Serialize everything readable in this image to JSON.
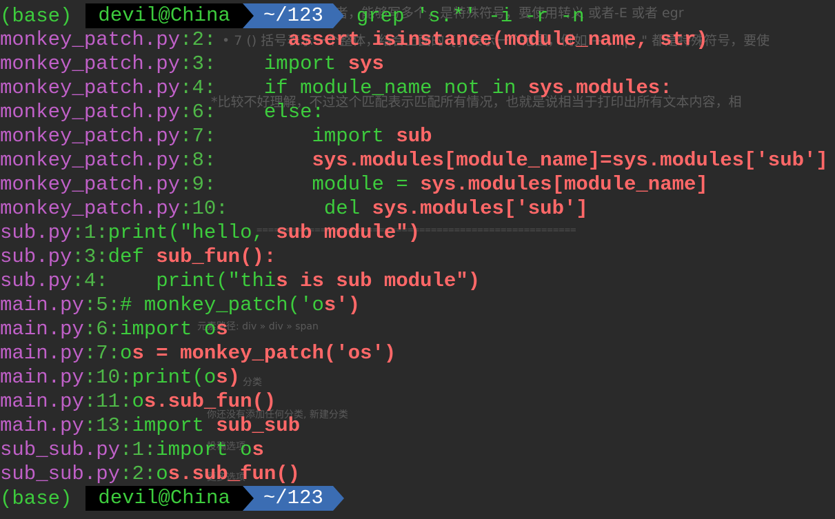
{
  "prompt": {
    "env": "(base)",
    "user_host": "devil@China",
    "dir": "~/123",
    "command": "grep 's.*' -i -r -n"
  },
  "lines": [
    {
      "file": "monkey_patch.py",
      "line": "2",
      "indent": "      ",
      "pre": "",
      "match": "assert isinstance(module_name, str)",
      "post": ""
    },
    {
      "file": "monkey_patch.py",
      "line": "3",
      "indent": "    ",
      "pre": "import ",
      "match": "sys",
      "post": ""
    },
    {
      "file": "monkey_patch.py",
      "line": "4",
      "indent": "    ",
      "pre": "if module_name not in ",
      "match": "sys.modules:",
      "post": ""
    },
    {
      "file": "monkey_patch.py",
      "line": "6",
      "indent": "    ",
      "pre": "else:",
      "match": "",
      "post": ""
    },
    {
      "file": "monkey_patch.py",
      "line": "7",
      "indent": "        ",
      "pre": "import ",
      "match": "sub",
      "post": ""
    },
    {
      "file": "monkey_patch.py",
      "line": "8",
      "indent": "        ",
      "pre": "",
      "match": "sys.modules[module_name]=sys.modules['sub']",
      "post": ""
    },
    {
      "file": "monkey_patch.py",
      "line": "9",
      "indent": "        ",
      "pre": "module = ",
      "match": "sys.modules[module_name]",
      "post": ""
    },
    {
      "file": "monkey_patch.py",
      "line": "10",
      "indent": "        ",
      "pre": "del ",
      "match": "sys.modules['sub']",
      "post": ""
    },
    {
      "file": "sub.py",
      "line": "1",
      "indent": "",
      "pre": "print(\"hello, ",
      "match": "sub module\")",
      "post": ""
    },
    {
      "file": "sub.py",
      "line": "3",
      "indent": "",
      "pre": "def ",
      "match": "sub_fun():",
      "post": ""
    },
    {
      "file": "sub.py",
      "line": "4",
      "indent": "    ",
      "pre": "print(\"thi",
      "match": "s is sub module\")",
      "post": ""
    },
    {
      "file": "main.py",
      "line": "5",
      "indent": "",
      "pre": "# monkey_patch('o",
      "match": "s')",
      "post": ""
    },
    {
      "file": "main.py",
      "line": "6",
      "indent": "",
      "pre": "import o",
      "match": "s",
      "post": ""
    },
    {
      "file": "main.py",
      "line": "7",
      "indent": "",
      "pre": "o",
      "match": "s = monkey_patch('os')",
      "post": ""
    },
    {
      "file": "main.py",
      "line": "10",
      "indent": "",
      "pre": "print(o",
      "match": "s)",
      "post": ""
    },
    {
      "file": "main.py",
      "line": "11",
      "indent": "",
      "pre": "o",
      "match": "s.sub_fun()",
      "post": ""
    },
    {
      "file": "main.py",
      "line": "13",
      "indent": "",
      "pre": "import ",
      "match": "sub_sub",
      "post": ""
    },
    {
      "file": "sub_sub.py",
      "line": "1",
      "indent": "",
      "pre": "import o",
      "match": "s",
      "post": ""
    },
    {
      "file": "sub_sub.py",
      "line": "2",
      "indent": "",
      "pre": "o",
      "match": "s.sub_fun()",
      "post": ""
    }
  ],
  "background_page": {
    "t1": "式里面表示或者，能够写多个，是特殊符号，要使用转义 或者-E 或者 egr",
    "t2": "• 7 () 括号表示一个整体，结合上面的 {} 表示一个范围，例如 + ，\\|、\" 都是特殊符号，要使",
    "t3": "*比较不好理解，不过这个匹配表示匹配所有情况，也就是说相当于打印出所有文本内容，相",
    "t4": "=======================================================",
    "t5": "元素路径: div » div » span",
    "t6": "分类",
    "t7": "你还没有添加任何分类, 新建分类",
    "t8": "投稿选项",
    "t9": "更多选项"
  }
}
